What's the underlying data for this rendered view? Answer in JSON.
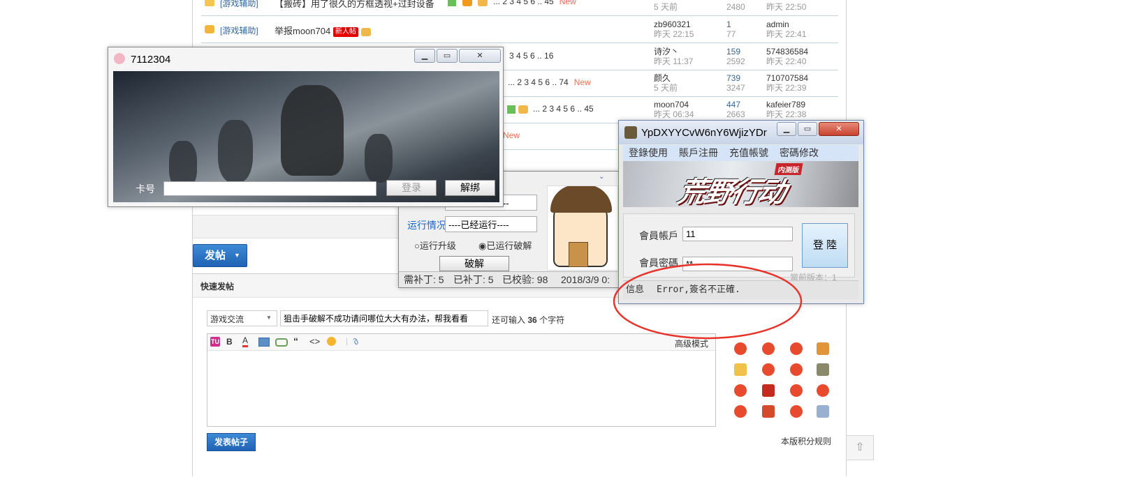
{
  "forum": {
    "rows": [
      {
        "category": "[游戏辅助]",
        "title": "【搬砖】用了很久的方框透视+过封设备",
        "pages": "... 2 3 4 5 6 .. 45",
        "new": "New",
        "author": "",
        "author_time": "5 天前",
        "replies": "",
        "views": "2480",
        "last_user": "",
        "last_time": "昨天 22:50"
      },
      {
        "category": "[游戏辅助]",
        "title": "举报moon704",
        "badge": "新人帖",
        "author": "zb960321",
        "author_time": "昨天 22:15",
        "replies": "1",
        "views": "77",
        "last_user": "admin",
        "last_time": "昨天 22:41"
      },
      {
        "pages": "3 4 5 6 .. 16",
        "author": "诗汐丶",
        "author_time": "昨天 11:37",
        "replies": "159",
        "views": "2592",
        "last_user": "574836584",
        "last_time": "昨天 22:40"
      },
      {
        "pages": "... 2 3 4 5 6 .. 74",
        "new": "New",
        "author": "颜久",
        "author_time": "5 天前",
        "replies": "739",
        "views": "3247",
        "last_user": "710707584",
        "last_time": "昨天 22:39"
      },
      {
        "pages": "... 2 3 4 5 6 .. 45",
        "author": "moon704",
        "author_time": "昨天 06:34",
        "replies": "447",
        "views": "2663",
        "last_user": "kafeier789",
        "last_time": "昨天 22:38"
      },
      {
        "new": "New"
      }
    ],
    "post_button": "发帖",
    "quick_post_title": "快速发帖",
    "category_select": "游戏交流",
    "subject_value": "狙击手破解不成功请问哪位大大有办法，帮我看看",
    "char_remaining_prefix": "还可输入",
    "char_remaining_count": "36",
    "char_remaining_suffix": "个字符",
    "advanced_mode": "高级模式",
    "submit_button": "发表帖子",
    "rules_link": "本版积分规则"
  },
  "card_window": {
    "title": "7112304",
    "card_label": "卡号",
    "card_value": "",
    "login_button": "登录",
    "unbind_button": "解绑"
  },
  "crack_window": {
    "status1_value": "----已经运行----",
    "run_label": "运行情况",
    "run_value": "----已经运行----",
    "radio1_label": "运行升级",
    "radio2_label": "已运行破解",
    "crack_button": "破解",
    "status_bar": [
      "需补丁: 5",
      "已补丁: 5",
      "已校验: 98",
      "2018/3/9 0:"
    ]
  },
  "game_window": {
    "title": "YpDXYYCvW6nY6WjizYDr",
    "menu": [
      "登錄使用",
      "賬戶注冊",
      "充值帳號",
      "密碼修改"
    ],
    "banner_text": "荒野行动",
    "banner_badge": "内测版",
    "account_label": "會員帳戶",
    "account_value": "11",
    "password_label": "會員密碼",
    "password_value": "**",
    "login_button": "登 陸",
    "version_text": "當前版本：1",
    "info_label": "信息",
    "info_message": "Error,簽名不正確.",
    "colors": {
      "menu_bg": "#d6e4f7",
      "highlight_circle": "#e8332a"
    }
  },
  "editor_toolbar": [
    "TU",
    "B",
    "A",
    "image",
    "link",
    "quote",
    "code",
    "emoji",
    "attach"
  ]
}
